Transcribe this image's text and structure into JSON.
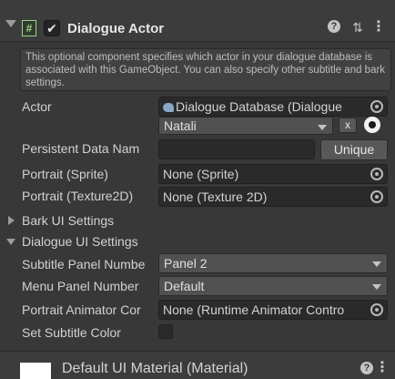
{
  "component": {
    "title": "Dialogue Actor",
    "enabled": true,
    "header_icons": [
      "script-icon",
      "help-icon",
      "preset-icon",
      "kebab-icon"
    ]
  },
  "help_box": "This optional component specifies which actor in your dialogue database is associated with this GameObject. You can also specify other subtitle and bark settings.",
  "fields": {
    "actor": {
      "label": "Actor",
      "database_value": "Dialogue Database (Dialogue",
      "actor_value": "Natali",
      "clear_label": "x"
    },
    "persistent_data_name": {
      "label": "Persistent Data Nam",
      "value": "",
      "button_label": "Unique"
    },
    "portrait_sprite": {
      "label": "Portrait (Sprite)",
      "value": "None (Sprite)"
    },
    "portrait_texture": {
      "label": "Portrait (Texture2D)",
      "value": "None (Texture 2D)"
    }
  },
  "sections": {
    "bark_ui": {
      "label": "Bark UI Settings",
      "expanded": false
    },
    "dialogue_ui": {
      "label": "Dialogue UI Settings",
      "expanded": true
    }
  },
  "dialogue_ui": {
    "subtitle_panel": {
      "label": "Subtitle Panel Numbe",
      "value": "Panel 2"
    },
    "menu_panel": {
      "label": "Menu Panel Number",
      "value": "Default"
    },
    "portrait_animator": {
      "label": "Portrait Animator Cor",
      "value": "None (Runtime Animator Contro"
    },
    "set_subtitle_color": {
      "label": "Set Subtitle Color",
      "checked": false
    }
  },
  "material": {
    "title": "Default UI Material (Material)"
  }
}
